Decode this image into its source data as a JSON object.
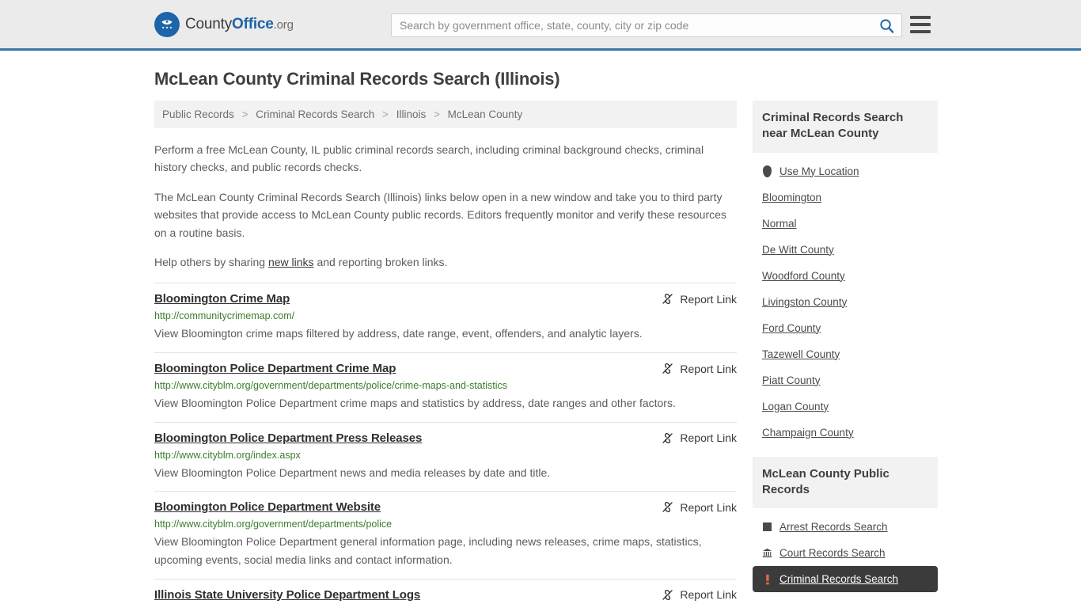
{
  "header": {
    "logo": {
      "icon": "eagle-seal-icon",
      "text_county": "County",
      "text_office": "Office",
      "text_org": ".org"
    },
    "search": {
      "placeholder": "Search by government office, state, county, city or zip code",
      "value": "",
      "search_icon": "search-icon"
    },
    "menu_icon": "hamburger-menu-icon"
  },
  "page": {
    "title": "McLean County Criminal Records Search (Illinois)"
  },
  "breadcrumb": {
    "separator": ">",
    "items": [
      {
        "label": "Public Records"
      },
      {
        "label": "Criminal Records Search"
      },
      {
        "label": "Illinois"
      },
      {
        "label": "McLean County"
      }
    ]
  },
  "intro": {
    "p1": "Perform a free McLean County, IL public criminal records search, including criminal background checks, criminal history checks, and public records checks.",
    "p2": "The McLean County Criminal Records Search (Illinois) links below open in a new window and take you to third party websites that provide access to McLean County public records. Editors frequently monitor and verify these resources on a routine basis.",
    "p3_before": "Help others by sharing ",
    "p3_link": "new links",
    "p3_after": " and reporting broken links."
  },
  "results": {
    "report_label": "Report Link",
    "report_icon": "broken-link-icon",
    "items": [
      {
        "title": "Bloomington Crime Map",
        "url": "http://communitycrimemap.com/",
        "description": "View Bloomington crime maps filtered by address, date range, event, offenders, and analytic layers."
      },
      {
        "title": "Bloomington Police Department Crime Map",
        "url": "http://www.cityblm.org/government/departments/police/crime-maps-and-statistics",
        "description": "View Bloomington Police Department crime maps and statistics by address, date ranges and other factors."
      },
      {
        "title": "Bloomington Police Department Press Releases",
        "url": "http://www.cityblm.org/index.aspx",
        "description": "View Bloomington Police Department news and media releases by date and title."
      },
      {
        "title": "Bloomington Police Department Website",
        "url": "http://www.cityblm.org/government/departments/police",
        "description": "View Bloomington Police Department general information page, including news releases, crime maps, statistics, upcoming events, social media links and contact information."
      },
      {
        "title": "Illinois State University Police Department Logs",
        "url": "",
        "description": ""
      }
    ]
  },
  "sidebar": {
    "nearby": {
      "heading": "Criminal Records Search near McLean County",
      "items": [
        {
          "label": "Use My Location",
          "icon": "map-pin-icon"
        },
        {
          "label": "Bloomington",
          "icon": ""
        },
        {
          "label": "Normal",
          "icon": ""
        },
        {
          "label": "De Witt County",
          "icon": ""
        },
        {
          "label": "Woodford County",
          "icon": ""
        },
        {
          "label": "Livingston County",
          "icon": ""
        },
        {
          "label": "Ford County",
          "icon": ""
        },
        {
          "label": "Tazewell County",
          "icon": ""
        },
        {
          "label": "Piatt County",
          "icon": ""
        },
        {
          "label": "Logan County",
          "icon": ""
        },
        {
          "label": "Champaign County",
          "icon": ""
        }
      ]
    },
    "public_records": {
      "heading": "McLean County Public Records",
      "items": [
        {
          "label": "Arrest Records Search",
          "icon": "fingerprint-square-icon",
          "active": false
        },
        {
          "label": "Court Records Search",
          "icon": "courthouse-icon",
          "active": false
        },
        {
          "label": "Criminal Records Search",
          "icon": "exclamation-icon",
          "active": true
        }
      ]
    }
  },
  "colors": {
    "header_bg": "#ebebeb",
    "header_rule": "#3a76a8",
    "brand_blue": "#1d64a8",
    "url_green": "#3a7d2c",
    "panel_gray": "#f2f2f2",
    "active_dark": "#3b3b3b"
  }
}
